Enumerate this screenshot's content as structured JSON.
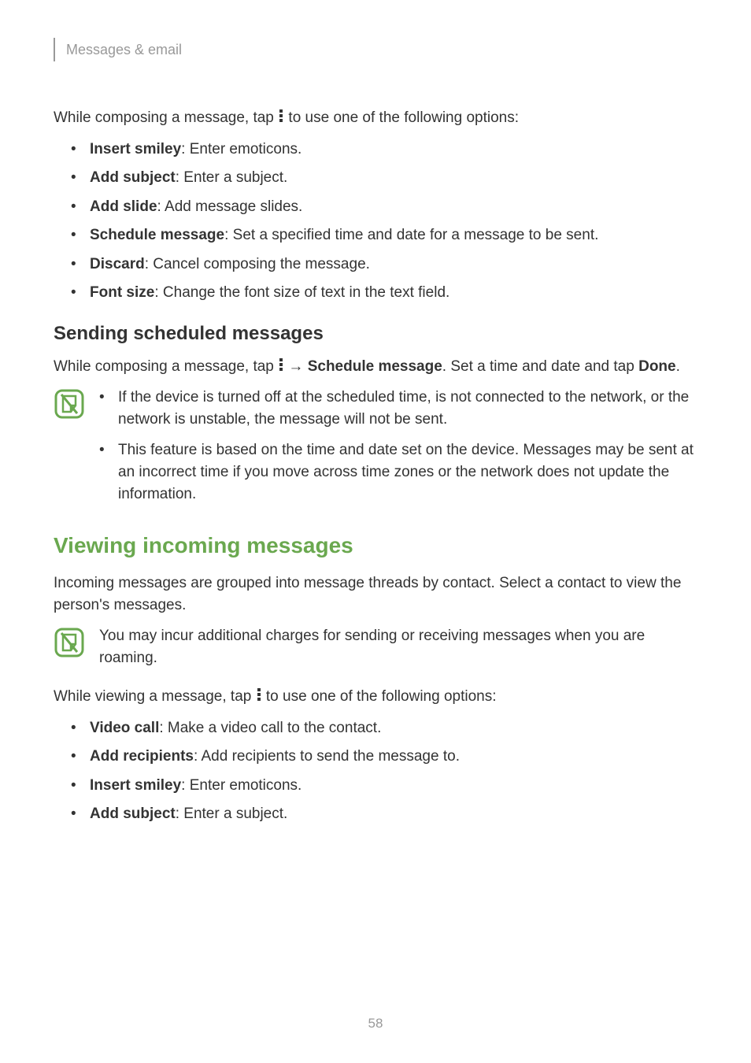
{
  "header": {
    "breadcrumb": "Messages & email"
  },
  "intro1": {
    "pre": "While composing a message, tap ",
    "post": " to use one of the following options:"
  },
  "list1": [
    {
      "b": "Insert smiley",
      "t": ": Enter emoticons."
    },
    {
      "b": "Add subject",
      "t": ": Enter a subject."
    },
    {
      "b": "Add slide",
      "t": ": Add message slides."
    },
    {
      "b": "Schedule message",
      "t": ": Set a specified time and date for a message to be sent."
    },
    {
      "b": "Discard",
      "t": ": Cancel composing the message."
    },
    {
      "b": "Font size",
      "t": ": Change the font size of text in the text field."
    }
  ],
  "subheading1": "Sending scheduled messages",
  "sched": {
    "pre": "While composing a message, tap ",
    "arrow": " → ",
    "b1": "Schedule message",
    "mid": ". Set a time and date and tap ",
    "b2": "Done",
    "end": "."
  },
  "note1": [
    "If the device is turned off at the scheduled time, is not connected to the network, or the network is unstable, the message will not be sent.",
    "This feature is based on the time and date set on the device. Messages may be sent at an incorrect time if you move across time zones or the network does not update the information."
  ],
  "section_heading": "Viewing incoming messages",
  "incoming_para": "Incoming messages are grouped into message threads by contact. Select a contact to view the person's messages.",
  "note2": "You may incur additional charges for sending or receiving messages when you are roaming.",
  "intro2": {
    "pre": "While viewing a message, tap ",
    "post": " to use one of the following options:"
  },
  "list2": [
    {
      "b": "Video call",
      "t": ": Make a video call to the contact."
    },
    {
      "b": "Add recipients",
      "t": ": Add recipients to send the message to."
    },
    {
      "b": "Insert smiley",
      "t": ": Enter emoticons."
    },
    {
      "b": "Add subject",
      "t": ": Enter a subject."
    }
  ],
  "page_number": "58"
}
